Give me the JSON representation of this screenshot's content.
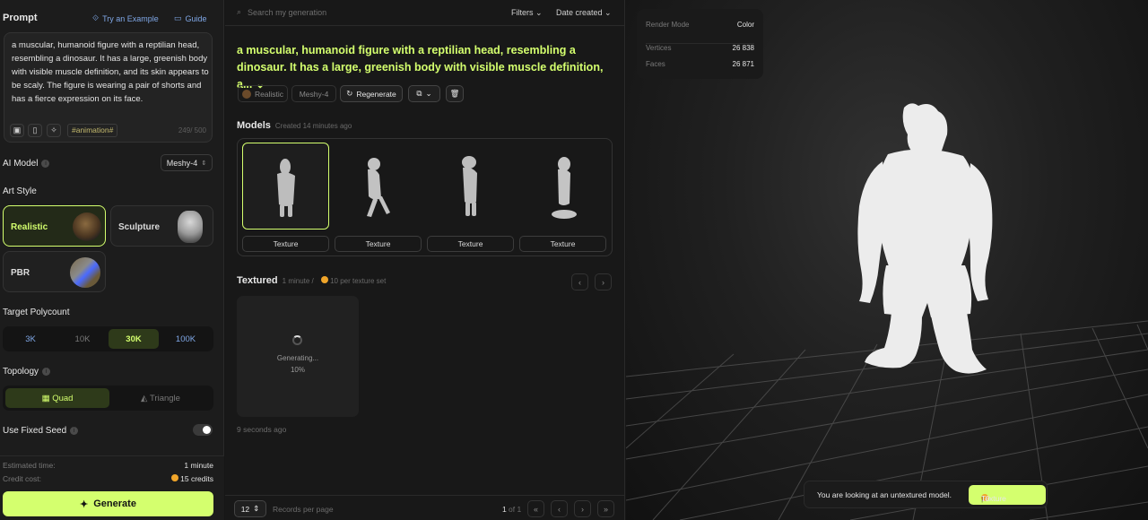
{
  "left": {
    "prompt_label": "Prompt",
    "try_example": "Try an Example",
    "guide": "Guide",
    "prompt_text": "a muscular, humanoid figure with a reptilian head, resembling a dinosaur. It has a large, greenish body with visible muscle definition, and its skin appears to be scaly. The figure is wearing a pair of shorts and has a fierce expression on its face.",
    "tag": "#animation#",
    "char_count": "249/ 500",
    "ai_model_label": "AI Model",
    "ai_model_value": "Meshy-4",
    "art_style_label": "Art Style",
    "styles": [
      "Realistic",
      "Sculpture",
      "PBR"
    ],
    "polycount_label": "Target Polycount",
    "polycounts": [
      "3K",
      "10K",
      "30K",
      "100K"
    ],
    "polycount_selected": "30K",
    "topology_label": "Topology",
    "topologies": [
      "Quad",
      "Triangle"
    ],
    "fixed_seed_label": "Use Fixed Seed",
    "fixed_seed_on": false,
    "est_time_label": "Estimated time:",
    "est_time_value": "1 minute",
    "credit_label": "Credit cost:",
    "credit_value": "15 credits",
    "generate": "Generate"
  },
  "middle": {
    "search_placeholder": "Search my generation",
    "filters": "Filters",
    "sort": "Date created",
    "title": "a muscular, humanoid figure with a reptilian head, resembling a dinosaur. It has a large, greenish body with visible muscle definition, a...",
    "chip_style": "Realistic",
    "chip_model": "Meshy-4",
    "regenerate": "Regenerate",
    "models_label": "Models",
    "models_created": "Created 14 minutes ago",
    "texture_buttons": [
      "Texture",
      "Texture",
      "Texture",
      "Texture"
    ],
    "textured_label": "Textured",
    "textured_time": "1 minute /",
    "textured_cost": "10 per texture set",
    "generating": "Generating...",
    "progress": "10%",
    "progress_value": 10,
    "gen_time": "9 seconds ago",
    "records_value": "12",
    "records_label": "Records per page",
    "page_current": "1",
    "page_total": "of 1"
  },
  "viewer": {
    "render_mode_label": "Render Mode",
    "render_mode_value": "Color",
    "vertices_label": "Vertices",
    "vertices_value": "26 838",
    "faces_label": "Faces",
    "faces_value": "26 871",
    "notice": "You are looking at an untextured model.",
    "texture_cost": "10",
    "texture_btn": "Texture"
  },
  "colors": {
    "accent": "#d4ff6e",
    "link": "#7fa7e6",
    "coin": "#f0a52a"
  }
}
